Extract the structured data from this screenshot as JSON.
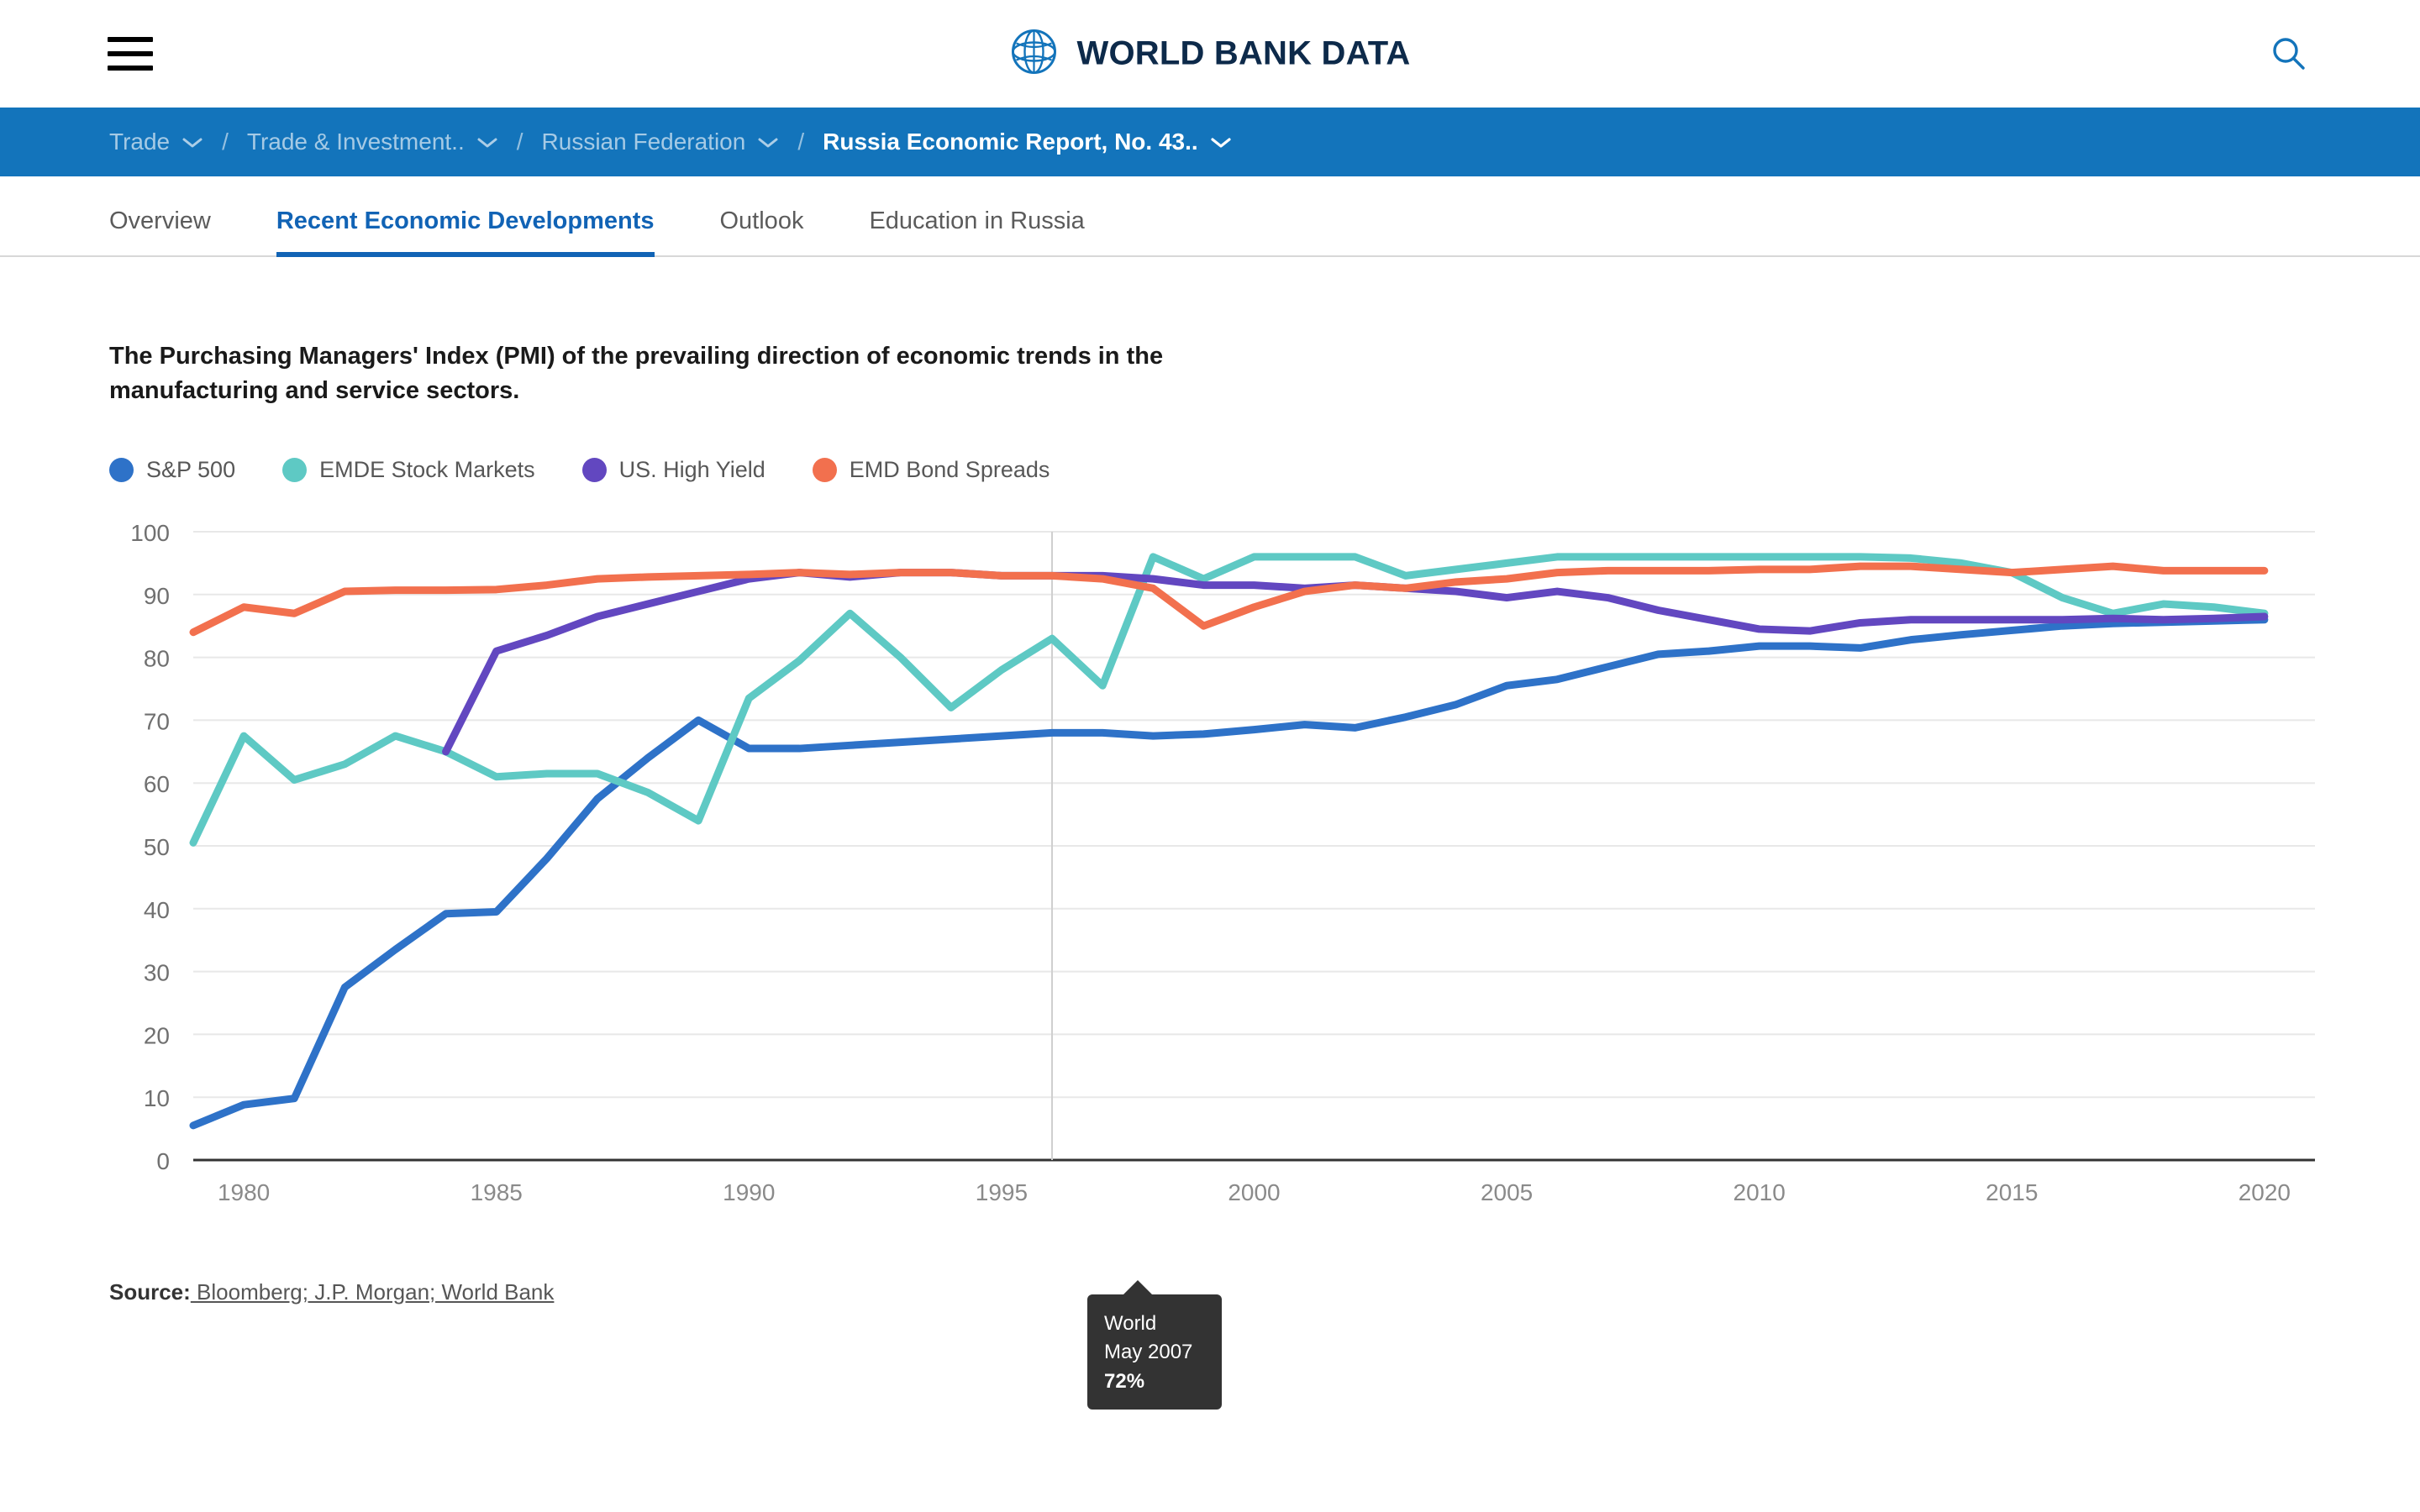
{
  "header": {
    "brand_title": "WORLD BANK DATA",
    "menu_icon": "hamburger-menu-icon",
    "logo_icon": "world-bank-globe-icon",
    "search_icon": "search-icon"
  },
  "breadcrumb": {
    "separator": "/",
    "items": [
      {
        "label": "Trade",
        "has_chevron": true,
        "active": false
      },
      {
        "label": "Trade & Investment..",
        "has_chevron": true,
        "active": false
      },
      {
        "label": "Russian Federation",
        "has_chevron": true,
        "active": false
      },
      {
        "label": "Russia Economic Report, No. 43..",
        "has_chevron": true,
        "active": true
      }
    ]
  },
  "tabs": [
    {
      "label": "Overview",
      "active": false
    },
    {
      "label": "Recent Economic Developments",
      "active": true
    },
    {
      "label": "Outlook",
      "active": false
    },
    {
      "label": "Education in Russia",
      "active": false
    }
  ],
  "tooltip": {
    "region": "World",
    "date": "May 2007",
    "value": "72%"
  },
  "source": {
    "label": "Source:",
    "text": " Bloomberg; J.P. Morgan; World Bank"
  },
  "colors": {
    "brand_blue": "#1374bb",
    "tab_active": "#1163b5",
    "sp500": "#2e72c8",
    "emde": "#5ec9c4",
    "high_yield": "#6247c0",
    "emd_bond": "#f2704e",
    "tooltip_bg": "#333333",
    "grid": "#e8e8e8",
    "axis": "#333333"
  },
  "chart_data": {
    "type": "line",
    "title": "The Purchasing Managers' Index (PMI) of the prevailing direction of economic trends in the manufacturing and service sectors.",
    "xlabel": "",
    "ylabel": "",
    "xlim": [
      1979,
      2021
    ],
    "ylim": [
      0,
      100
    ],
    "grid": true,
    "legend_position": "top-left",
    "yticks": [
      0,
      10,
      20,
      30,
      40,
      50,
      60,
      70,
      80,
      90,
      100
    ],
    "xticks": [
      1980,
      1985,
      1990,
      1995,
      2000,
      2005,
      2010,
      2015,
      2020
    ],
    "x": [
      1979,
      1980,
      1981,
      1982,
      1983,
      1984,
      1985,
      1986,
      1987,
      1988,
      1989,
      1990,
      1991,
      1992,
      1993,
      1994,
      1995,
      1996,
      1997,
      1998,
      1999,
      2000,
      2001,
      2002,
      2003,
      2004,
      2005,
      2006,
      2007,
      2008,
      2009,
      2010,
      2011,
      2012,
      2013,
      2014,
      2015,
      2016,
      2017,
      2018,
      2019,
      2020
    ],
    "series": [
      {
        "name": "S&P 500",
        "color": "#2e72c8",
        "values": [
          5.5,
          8.8,
          9.8,
          27.5,
          33.5,
          39.2,
          39.5,
          48.0,
          57.5,
          64.0,
          70.0,
          65.5,
          65.5,
          66.0,
          66.5,
          67.0,
          67.5,
          68.0,
          68.0,
          67.5,
          67.8,
          68.5,
          69.3,
          68.8,
          70.5,
          72.5,
          75.5,
          76.5,
          78.5,
          80.5,
          81.0,
          81.8,
          81.8,
          81.5,
          82.8,
          83.6,
          84.3,
          85.0,
          85.4,
          85.6,
          85.8,
          86.0
        ]
      },
      {
        "name": "EMDE Stock Markets",
        "color": "#5ec9c4",
        "values": [
          50.5,
          67.5,
          60.5,
          63.0,
          67.5,
          65.0,
          61.0,
          61.5,
          61.5,
          58.5,
          54.0,
          73.5,
          79.5,
          87.0,
          80.0,
          72.0,
          78.0,
          83.0,
          75.5,
          96.0,
          92.5,
          96.0,
          96.0,
          96.0,
          93.0,
          94.0,
          95.0,
          96.0,
          96.0,
          96.0,
          96.0,
          96.0,
          96.0,
          96.0,
          95.8,
          95.0,
          93.5,
          89.5,
          87.0,
          88.5,
          88.0,
          87.0
        ]
      },
      {
        "name": "US. High Yield",
        "color": "#6247c0",
        "values": [
          null,
          null,
          null,
          null,
          null,
          65.0,
          81.0,
          83.5,
          86.5,
          88.5,
          90.5,
          92.5,
          93.5,
          92.8,
          93.5,
          93.5,
          93.0,
          93.0,
          93.0,
          92.5,
          91.5,
          91.5,
          91.0,
          91.5,
          91.0,
          90.5,
          89.5,
          90.5,
          89.5,
          87.5,
          86.0,
          84.5,
          84.2,
          85.5,
          86.0,
          86.0,
          86.0,
          86.0,
          86.2,
          86.0,
          86.2,
          86.5
        ]
      },
      {
        "name": "EMD Bond Spreads",
        "color": "#f2704e",
        "values": [
          84.0,
          88.0,
          87.0,
          90.5,
          90.7,
          90.7,
          90.8,
          91.5,
          92.5,
          92.8,
          93.0,
          93.2,
          93.5,
          93.2,
          93.5,
          93.5,
          93.0,
          93.0,
          92.5,
          91.0,
          85.0,
          88.0,
          90.5,
          91.5,
          91.0,
          92.0,
          92.5,
          93.5,
          93.8,
          93.8,
          93.8,
          94.0,
          94.0,
          94.5,
          94.5,
          94.0,
          93.5,
          94.0,
          94.5,
          93.8,
          93.8,
          93.8
        ]
      }
    ],
    "annotation": {
      "x": 1996,
      "label": "World / May 2007 / 72%",
      "crosshair": true
    }
  }
}
